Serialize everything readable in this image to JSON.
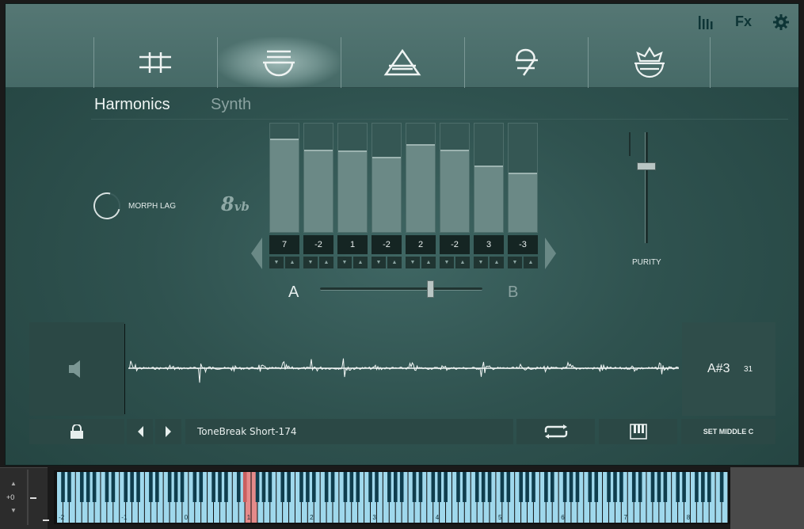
{
  "toolbar": {
    "fx_label": "Fx",
    "icons": [
      "mixer-bars-icon",
      "fx-icon",
      "gear-icon"
    ]
  },
  "tabs": [
    {
      "name": "tab-1",
      "icon": "double-bar-rune-icon",
      "active": false
    },
    {
      "name": "tab-2",
      "icon": "bowl-rune-icon",
      "active": true
    },
    {
      "name": "tab-3",
      "icon": "triangle-rune-icon",
      "active": false
    },
    {
      "name": "tab-4",
      "icon": "nine-rune-icon",
      "active": false
    },
    {
      "name": "tab-5",
      "icon": "lotus-bowl-icon",
      "active": false
    }
  ],
  "subtabs": {
    "harmonics": "Harmonics",
    "synth": "Synth",
    "active": "harmonics"
  },
  "morph": {
    "label": "MORPH LAG",
    "octave_main": "8",
    "octave_suffix": "vb"
  },
  "harmonics": {
    "values": [
      "7",
      "-2",
      "1",
      "-2",
      "2",
      "-2",
      "3",
      "-3"
    ],
    "levels": [
      0.86,
      0.76,
      0.75,
      0.69,
      0.81,
      0.76,
      0.61,
      0.55
    ]
  },
  "ab": {
    "a_label": "A",
    "b_label": "B",
    "position": 0.68
  },
  "purity": {
    "label": "PURITY",
    "position": 0.27
  },
  "sample": {
    "name": "ToneBreak Short-174",
    "note": "A#3",
    "note_number": "31",
    "set_middle_c": "SET MIDDLE C"
  },
  "keyboard": {
    "octave_shift": "+0",
    "octave_labels": [
      "-2",
      "-1",
      "0",
      "1",
      "2",
      "3",
      "4",
      "5",
      "6",
      "7",
      "8"
    ],
    "highlight_color": "#e58a8a",
    "key_color": "#9fd8ec",
    "marker_color": "#9ab02a"
  },
  "colors": {
    "accent": "#0e3536",
    "panel": "#345753"
  }
}
